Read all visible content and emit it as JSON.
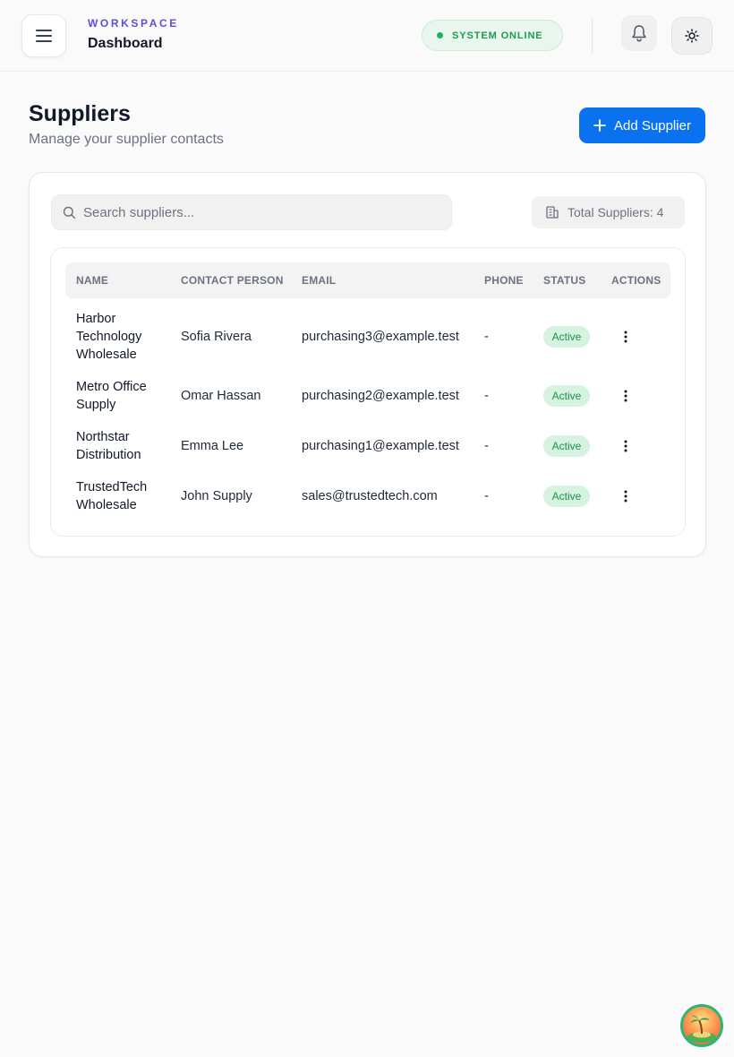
{
  "header": {
    "kicker": "WORKSPACE",
    "title": "Dashboard",
    "status": "SYSTEM ONLINE",
    "icons": {
      "menu": "menu-icon",
      "bell": "bell-icon",
      "theme": "sun-icon"
    }
  },
  "page": {
    "title": "Suppliers",
    "subtitle": "Manage your supplier contacts",
    "add_button_label": "Add Supplier"
  },
  "toolbar": {
    "search_placeholder": "Search suppliers...",
    "total_label": "Total Suppliers: 4"
  },
  "table": {
    "columns": [
      "NAME",
      "CONTACT PERSON",
      "EMAIL",
      "PHONE",
      "STATUS",
      "ACTIONS"
    ],
    "rows": [
      {
        "name": "Harbor Technology Wholesale",
        "contact": "Sofia Rivera",
        "email": "purchasing3@example.test",
        "phone": "-",
        "status": "Active"
      },
      {
        "name": "Metro Office Supply",
        "contact": "Omar Hassan",
        "email": "purchasing2@example.test",
        "phone": "-",
        "status": "Active"
      },
      {
        "name": "Northstar Distribution",
        "contact": "Emma Lee",
        "email": "purchasing1@example.test",
        "phone": "-",
        "status": "Active"
      },
      {
        "name": "TrustedTech Wholesale",
        "contact": "John Supply",
        "email": "sales@trustedtech.com",
        "phone": "-",
        "status": "Active"
      }
    ]
  },
  "colors": {
    "accent": "#0a72ef",
    "brand": "#5b4fd6",
    "status_green": "#1fb25a",
    "badge_bg": "#d6f3e1"
  }
}
